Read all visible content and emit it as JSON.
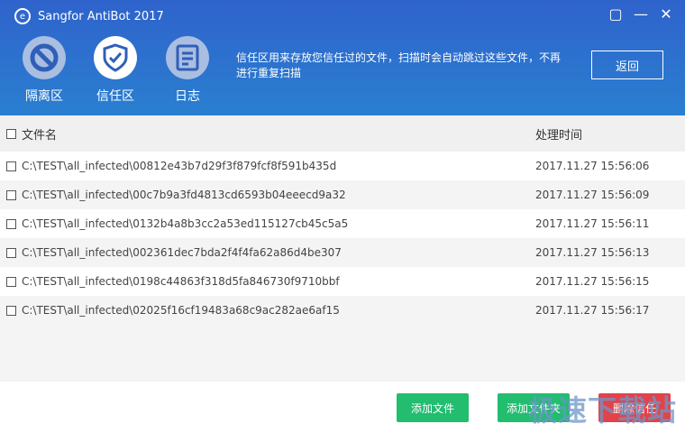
{
  "window": {
    "title": "Sangfor AntiBot 2017",
    "icons": [
      "restore-icon",
      "minimize-icon",
      "close-icon"
    ]
  },
  "nav": [
    {
      "label": "隔离区",
      "icon": "block-icon"
    },
    {
      "label": "信任区",
      "icon": "shield-check-icon"
    },
    {
      "label": "日志",
      "icon": "log-icon"
    }
  ],
  "description": "信任区用来存放您信任过的文件，扫描时会自动跳过这些文件，不再进行重复扫描",
  "back_label": "返回",
  "table": {
    "headers": [
      "文件名",
      "处理时间"
    ],
    "rows": [
      [
        "C:\\TEST\\all_infected\\00812e43b7d29f3f879fcf8f591b435d",
        "2017.11.27 15:56:06"
      ],
      [
        "C:\\TEST\\all_infected\\00c7b9a3fd4813cd6593b04eeecd9a32",
        "2017.11.27 15:56:09"
      ],
      [
        "C:\\TEST\\all_infected\\0132b4a8b3cc2a53ed115127cb45c5a5",
        "2017.11.27 15:56:11"
      ],
      [
        "C:\\TEST\\all_infected\\002361dec7bda2f4f4fa62a86d4be307",
        "2017.11.27 15:56:13"
      ],
      [
        "C:\\TEST\\all_infected\\0198c44863f318d5fa846730f9710bbf",
        "2017.11.27 15:56:15"
      ],
      [
        "C:\\TEST\\all_infected\\02025f16cf19483a68c9ac282ae6af15",
        "2017.11.27 15:56:17"
      ]
    ]
  },
  "buttons": {
    "add_file": "添加文件",
    "add_folder": "添加文件夹",
    "remove": "删除信任"
  },
  "watermark": "极速下载站"
}
